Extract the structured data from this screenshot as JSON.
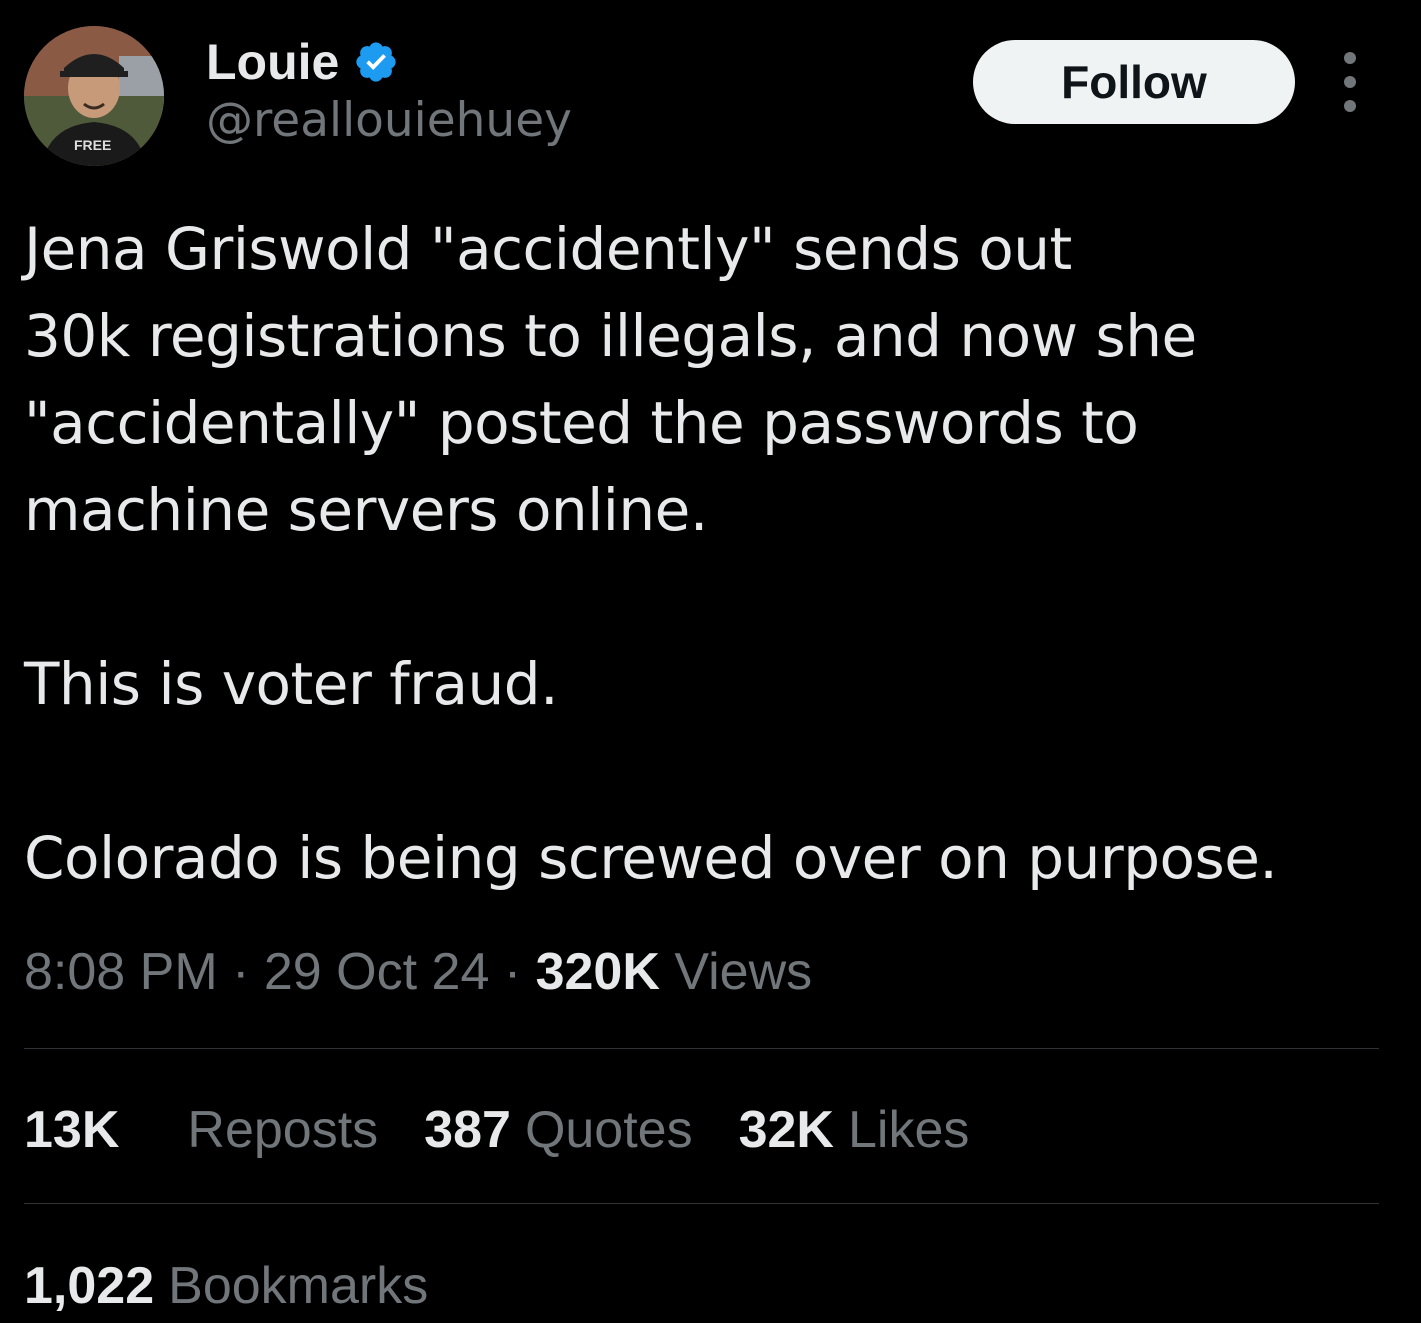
{
  "author": {
    "display_name": "Louie",
    "handle": "@reallouiehuey",
    "verified": true,
    "avatar_shirt_text": "FREE"
  },
  "actions": {
    "follow_label": "Follow"
  },
  "tweet": {
    "paragraphs": [
      "Jena Griswold \"accidently\" sends out\n30k registrations to illegals, and now she\n\"accidentally\" posted the passwords to\nmachine servers online.",
      "This is voter fraud.",
      "Colorado is being screwed over on purpose."
    ]
  },
  "meta": {
    "time": "8:08 PM",
    "separator": "·",
    "date": "29 Oct 24",
    "views_count": "320K",
    "views_label": "Views"
  },
  "stats": {
    "reposts_count": "13K",
    "reposts_label": "Reposts",
    "quotes_count": "387",
    "quotes_label": "Quotes",
    "likes_count": "32K",
    "likes_label": "Likes",
    "bookmarks_count": "1,022",
    "bookmarks_label": "Bookmarks"
  },
  "colors": {
    "background": "#000000",
    "primary_text": "#e7e9ea",
    "secondary_text": "#71767b",
    "verified_blue": "#1d9bf0",
    "divider": "#2f3336",
    "follow_bg": "#eff3f4"
  }
}
